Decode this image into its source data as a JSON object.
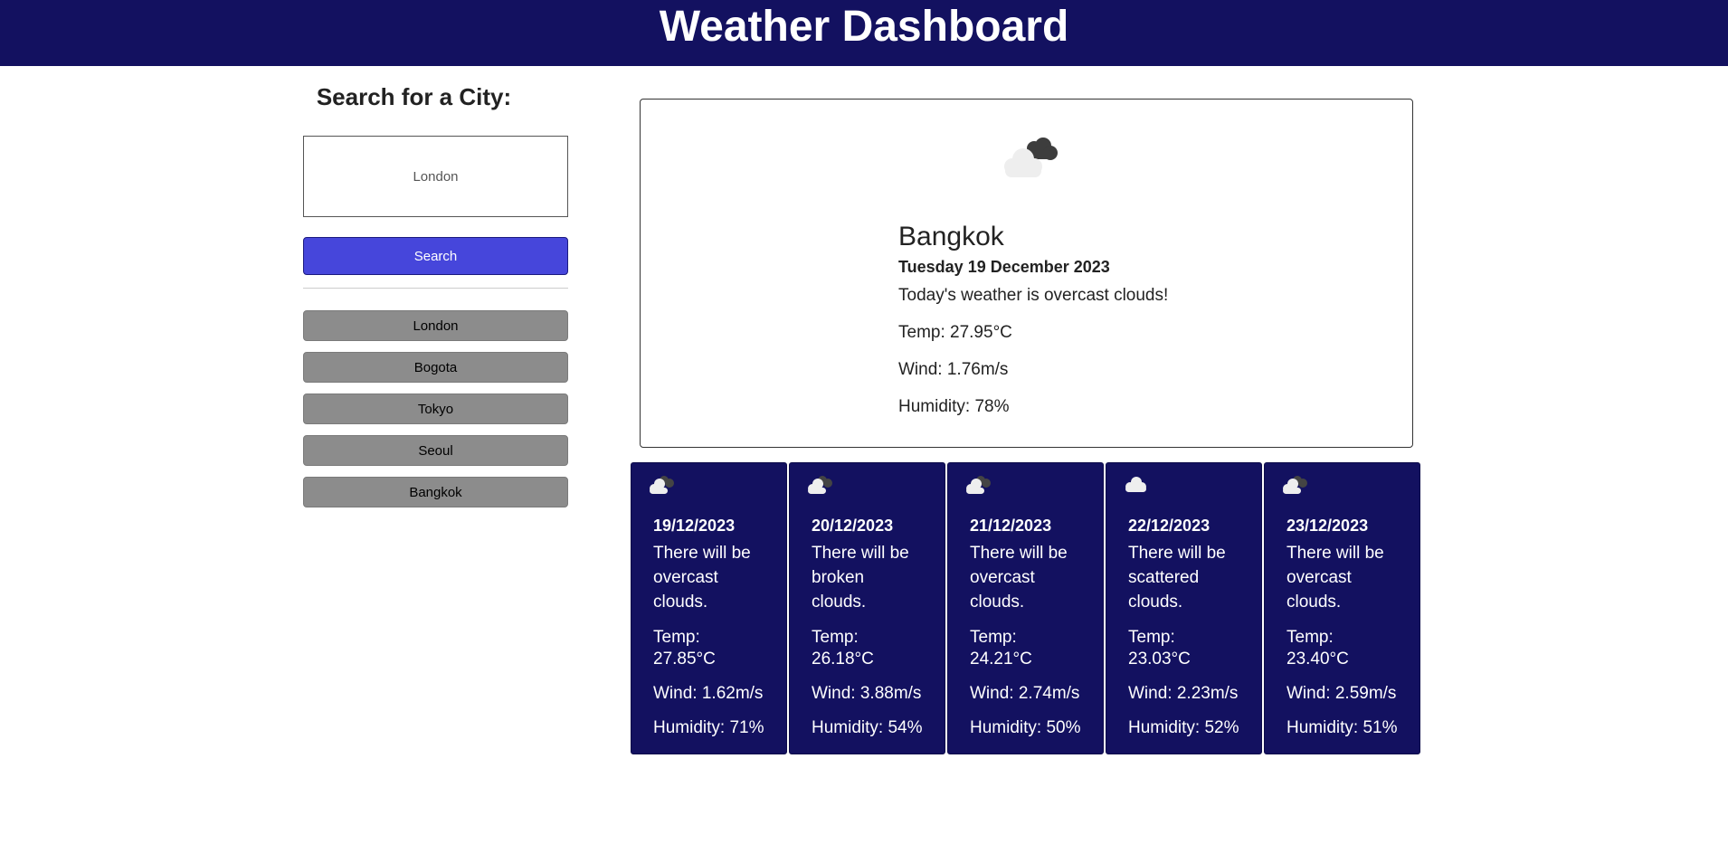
{
  "header": {
    "title": "Weather Dashboard"
  },
  "sidebar": {
    "title": "Search for a City:",
    "search_input": {
      "placeholder": "London",
      "value": ""
    },
    "search_button_label": "Search",
    "history": [
      {
        "label": "London"
      },
      {
        "label": "Bogota"
      },
      {
        "label": "Tokyo"
      },
      {
        "label": "Seoul"
      },
      {
        "label": "Bangkok"
      }
    ]
  },
  "current": {
    "icon": "overcast-clouds-icon",
    "city": "Bangkok",
    "date": "Tuesday 19 December 2023",
    "description": "Today's weather is overcast clouds!",
    "temp": "Temp: 27.95°C",
    "wind": "Wind: 1.76m/s",
    "humidity": "Humidity: 78%"
  },
  "forecast": [
    {
      "icon": "overcast-clouds-icon",
      "date": "19/12/2023",
      "description": "There will be overcast clouds.",
      "temp": "Temp: 27.85°C",
      "wind": "Wind: 1.62m/s",
      "humidity": "Humidity: 71%"
    },
    {
      "icon": "broken-clouds-icon",
      "date": "20/12/2023",
      "description": "There will be broken clouds.",
      "temp": "Temp: 26.18°C",
      "wind": "Wind: 3.88m/s",
      "humidity": "Humidity: 54%"
    },
    {
      "icon": "overcast-clouds-icon",
      "date": "21/12/2023",
      "description": "There will be overcast clouds.",
      "temp": "Temp: 24.21°C",
      "wind": "Wind: 2.74m/s",
      "humidity": "Humidity: 50%"
    },
    {
      "icon": "scattered-clouds-icon",
      "date": "22/12/2023",
      "description": "There will be scattered clouds.",
      "temp": "Temp: 23.03°C",
      "wind": "Wind: 2.23m/s",
      "humidity": "Humidity: 52%"
    },
    {
      "icon": "overcast-clouds-icon",
      "date": "23/12/2023",
      "description": "There will be overcast clouds.",
      "temp": "Temp: 23.40°C",
      "wind": "Wind: 2.59m/s",
      "humidity": "Humidity: 51%"
    }
  ],
  "colors": {
    "header_bg": "#131160",
    "search_button": "#4646db",
    "history_button": "#8c8c8c",
    "card_bg": "#131160"
  }
}
